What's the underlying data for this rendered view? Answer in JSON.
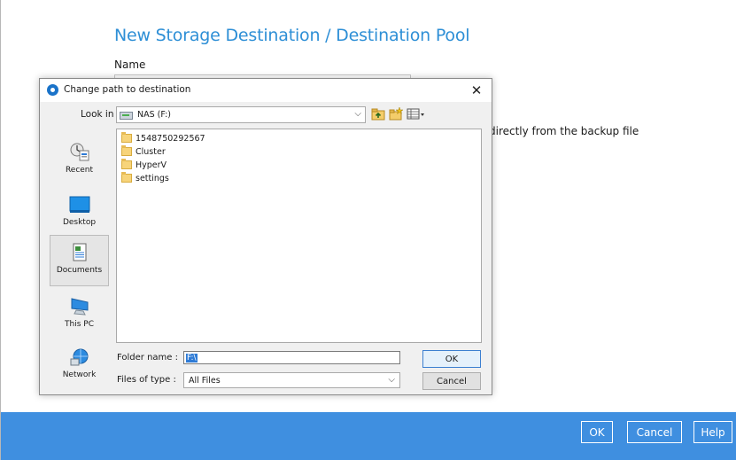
{
  "wizard": {
    "title": "New Storage Destination / Destination Pool",
    "name_label": "Name",
    "description_fragment": "directly from the backup file"
  },
  "footer": {
    "ok_label": "OK",
    "cancel_label": "Cancel",
    "help_label": "Help",
    "background_color": "#3f8fe0"
  },
  "dialog": {
    "title": "Change path to destination",
    "close_glyph": "✕",
    "look_in_label": "Look in :",
    "look_in_value": "NAS (F:)",
    "toolbar_icons": [
      "up-one-level-icon",
      "new-folder-icon",
      "view-menu-icon"
    ],
    "places": [
      {
        "label": "Recent",
        "icon": "recent-icon"
      },
      {
        "label": "Desktop",
        "icon": "desktop-icon"
      },
      {
        "label": "Documents",
        "icon": "documents-icon",
        "selected": true
      },
      {
        "label": "This PC",
        "icon": "this-pc-icon"
      },
      {
        "label": "Network",
        "icon": "network-icon"
      }
    ],
    "files": [
      "1548750292567",
      "Cluster",
      "HyperV",
      "settings"
    ],
    "folder_name_label": "Folder name :",
    "folder_name_value": "F:\\",
    "files_of_type_label": "Files of type :",
    "files_of_type_value": "All Files",
    "ok_label": "OK",
    "cancel_label": "Cancel"
  },
  "colors": {
    "accent": "#2e8fd6",
    "selection": "#2e7bd6"
  }
}
